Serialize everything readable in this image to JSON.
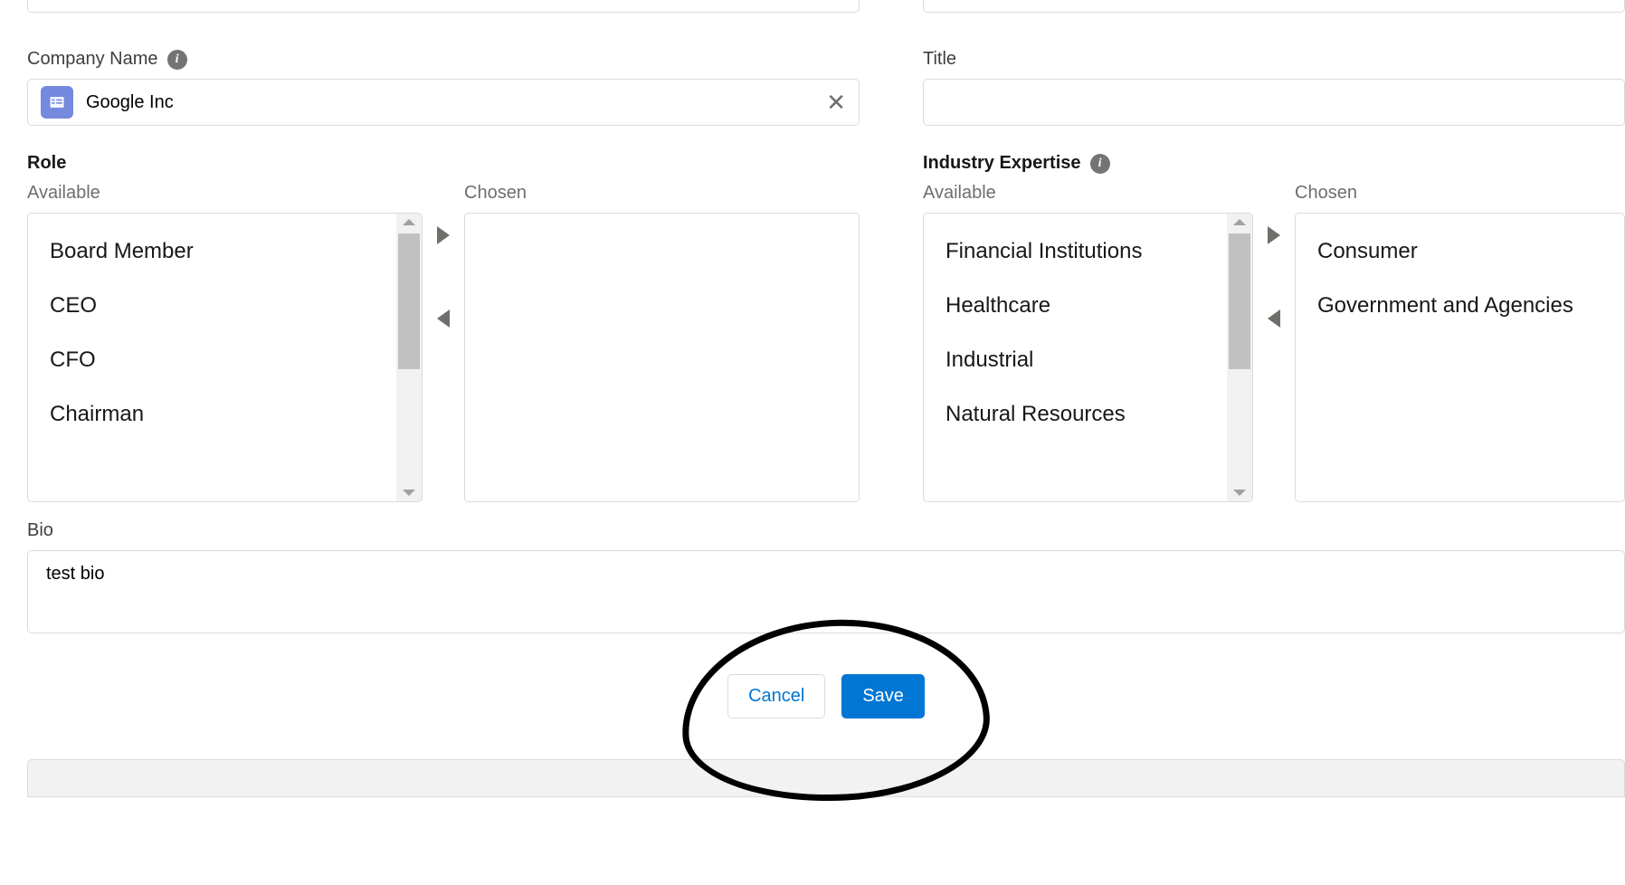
{
  "top_row": {
    "company_name_label": "Company Name",
    "company_name_value": "Google Inc",
    "title_label": "Title",
    "title_value": ""
  },
  "role": {
    "section_label": "Role",
    "available_label": "Available",
    "chosen_label": "Chosen",
    "available": [
      "Board Member",
      "CEO",
      "CFO",
      "Chairman"
    ],
    "chosen": []
  },
  "industry": {
    "section_label": "Industry Expertise",
    "available_label": "Available",
    "chosen_label": "Chosen",
    "available": [
      "Financial Institutions",
      "Healthcare",
      "Industrial",
      "Natural Resources"
    ],
    "chosen": [
      "Consumer",
      "Government and Agencies"
    ]
  },
  "bio": {
    "label": "Bio",
    "value": "test bio"
  },
  "buttons": {
    "cancel": "Cancel",
    "save": "Save"
  }
}
